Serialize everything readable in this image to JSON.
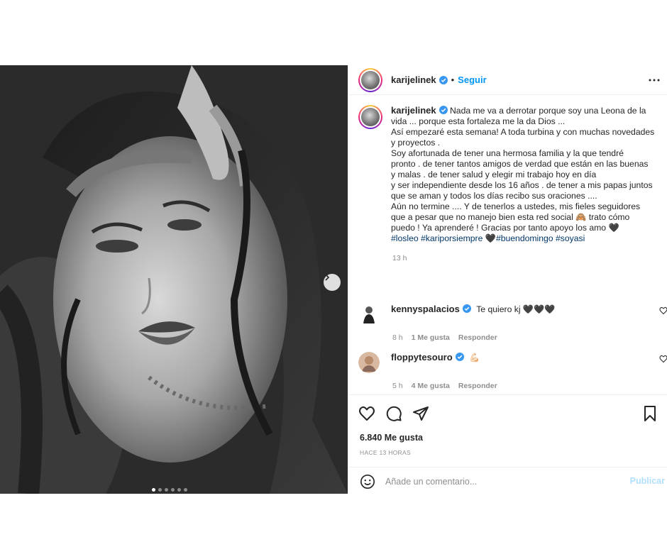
{
  "post": {
    "author": {
      "username": "karijelinek",
      "verified": true,
      "follow_label": "Seguir",
      "separator": "•"
    },
    "image": {
      "slide_count": 6,
      "active_slide": 1,
      "next_icon": "chevron-right-icon"
    },
    "caption": {
      "username": "karijelinek",
      "lines": [
        "Nada me va a derrotar porque soy una Leona de la",
        "vida ... porque esta fortaleza me la da Dios ...",
        "Así empezaré esta semana! A toda turbina y con muchas novedades",
        "y proyectos .",
        "Soy afortunada de tener una hermosa familia y la que tendré",
        "pronto . de tener tantos amigos de verdad que están en las buenas",
        "y malas . de tener salud y elegir mi trabajo hoy en día",
        "y ser independiente desde los 16 años . de tener a mis papas juntos",
        "que se aman y todos los días recibo sus oraciones ....",
        "Aún no termine .... Y de tenerlos a ustedes, mis fieles seguidores",
        "que a pesar que no manejo bien esta red social 🙈 trato cómo",
        "puedo ! Ya aprenderé ! Gracias por tanto apoyo los amo 🖤"
      ],
      "hashtags": "#losleo #kariporsiempre 🖤#buendomingo #soyasi",
      "time": "13 h"
    },
    "comments": [
      {
        "username": "kennyspalacios",
        "text": "Te quiero kj 🖤🖤🖤",
        "time": "8 h",
        "likes": "1 Me gusta",
        "reply": "Responder"
      },
      {
        "username": "floppytesouro",
        "text": "💪🏻",
        "time": "5 h",
        "likes": "4 Me gusta",
        "reply": "Responder"
      }
    ],
    "actions": {
      "like_icon": "heart-icon",
      "comment_icon": "comment-icon",
      "share_icon": "share-icon",
      "save_icon": "bookmark-icon"
    },
    "likes_count": "6.840 Me gusta",
    "posted_ago": "HACE 13 HORAS",
    "add_comment": {
      "placeholder": "Añade un comentario...",
      "publish_label": "Publicar"
    }
  }
}
